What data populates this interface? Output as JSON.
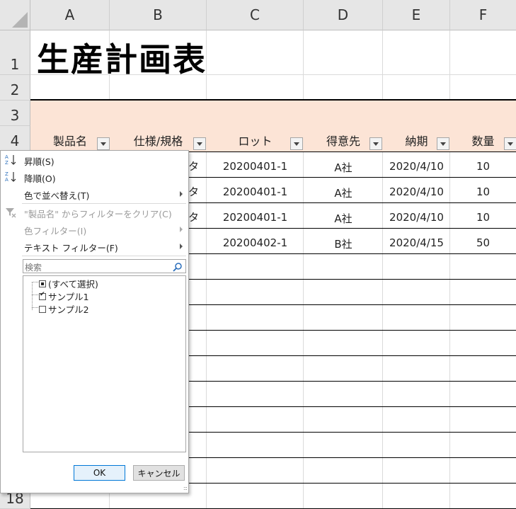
{
  "columns": [
    "A",
    "B",
    "C",
    "D",
    "E",
    "F"
  ],
  "rows": [
    "1",
    "2",
    "3",
    "4",
    "18"
  ],
  "sheet_title": "生産計画表",
  "headers": {
    "product": "製品名",
    "spec": "仕様/規格",
    "lot": "ロット",
    "customer": "得意先",
    "due": "納期",
    "qty": "数量"
  },
  "data_rows": [
    {
      "spec_frag": "タ",
      "lot": "20200401-1",
      "customer": "A社",
      "due": "2020/4/10",
      "qty": "10"
    },
    {
      "spec_frag": "タ",
      "lot": "20200401-1",
      "customer": "A社",
      "due": "2020/4/10",
      "qty": "10"
    },
    {
      "spec_frag": "タ",
      "lot": "20200401-1",
      "customer": "A社",
      "due": "2020/4/10",
      "qty": "10"
    },
    {
      "lot": "20200402-1",
      "customer": "B社",
      "due": "2020/4/15",
      "qty": "50"
    }
  ],
  "filter_menu": {
    "sort_asc": "昇順(S)",
    "sort_desc": "降順(O)",
    "sort_by_color": "色で並べ替え(T)",
    "clear_filter": "\"製品名\" からフィルターをクリア(C)",
    "color_filter": "色フィルター(I)",
    "text_filter": "テキスト フィルター(F)",
    "search_placeholder": "検索",
    "list": [
      {
        "label": "(すべて選択)",
        "state": "mixed"
      },
      {
        "label": "サンプル1",
        "state": "checked"
      },
      {
        "label": "サンプル2",
        "state": "unchecked"
      }
    ],
    "ok": "OK",
    "cancel": "キャンセル"
  },
  "colors": {
    "header_fill": "#fce4d6",
    "ok_border": "#0078d7"
  }
}
